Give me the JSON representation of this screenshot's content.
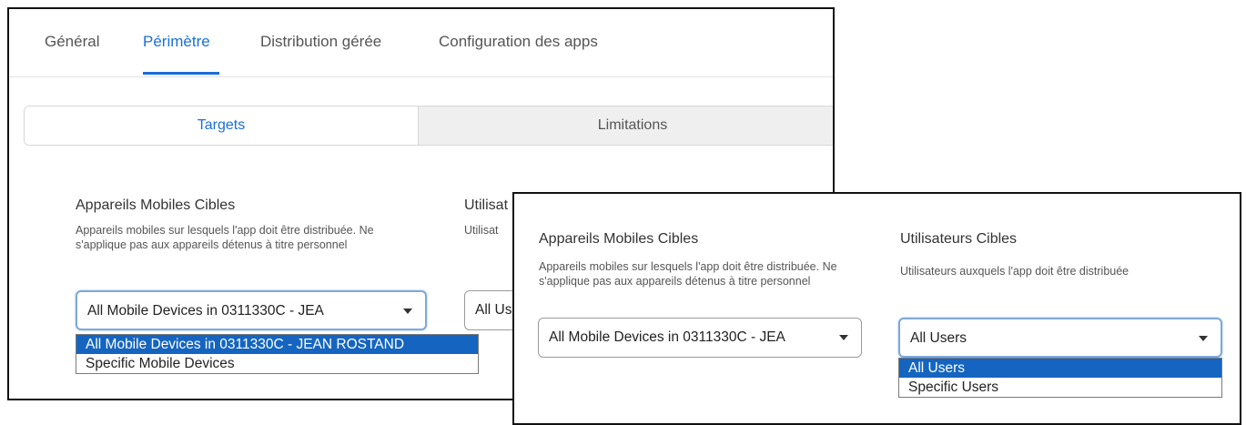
{
  "left_panel": {
    "tabs": [
      {
        "label": "Général"
      },
      {
        "label": "Périmètre"
      },
      {
        "label": "Distribution gérée"
      },
      {
        "label": "Configuration des apps"
      }
    ],
    "segments": {
      "targets": "Targets",
      "limitations": "Limitations"
    },
    "devices": {
      "heading": "Appareils Mobiles Cibles",
      "description": "Appareils mobiles sur lesquels l'app doit être distribuée. Ne s'applique pas aux appareils détenus à titre personnel",
      "selected": "All Mobile Devices in 0311330C - JEA",
      "options": [
        "All Mobile Devices in 0311330C - JEAN ROSTAND",
        "Specific Mobile Devices"
      ]
    },
    "users": {
      "heading_partial": "Utilisat",
      "description_partial": "Utilisat",
      "selected_partial": "All Us"
    }
  },
  "right_panel": {
    "devices": {
      "heading": "Appareils Mobiles Cibles",
      "description": "Appareils mobiles sur lesquels l'app doit être distribuée. Ne s'applique pas aux appareils détenus à titre personnel",
      "selected": "All Mobile Devices in 0311330C - JEA"
    },
    "users": {
      "heading": "Utilisateurs Cibles",
      "description": "Utilisateurs auxquels l'app doit être distribuée",
      "selected": "All Users",
      "options": [
        "All Users",
        "Specific Users"
      ]
    }
  },
  "colors": {
    "accent": "#1a6fd6",
    "selected_option": "#1565c0",
    "inactive_segment": "#efefef"
  }
}
